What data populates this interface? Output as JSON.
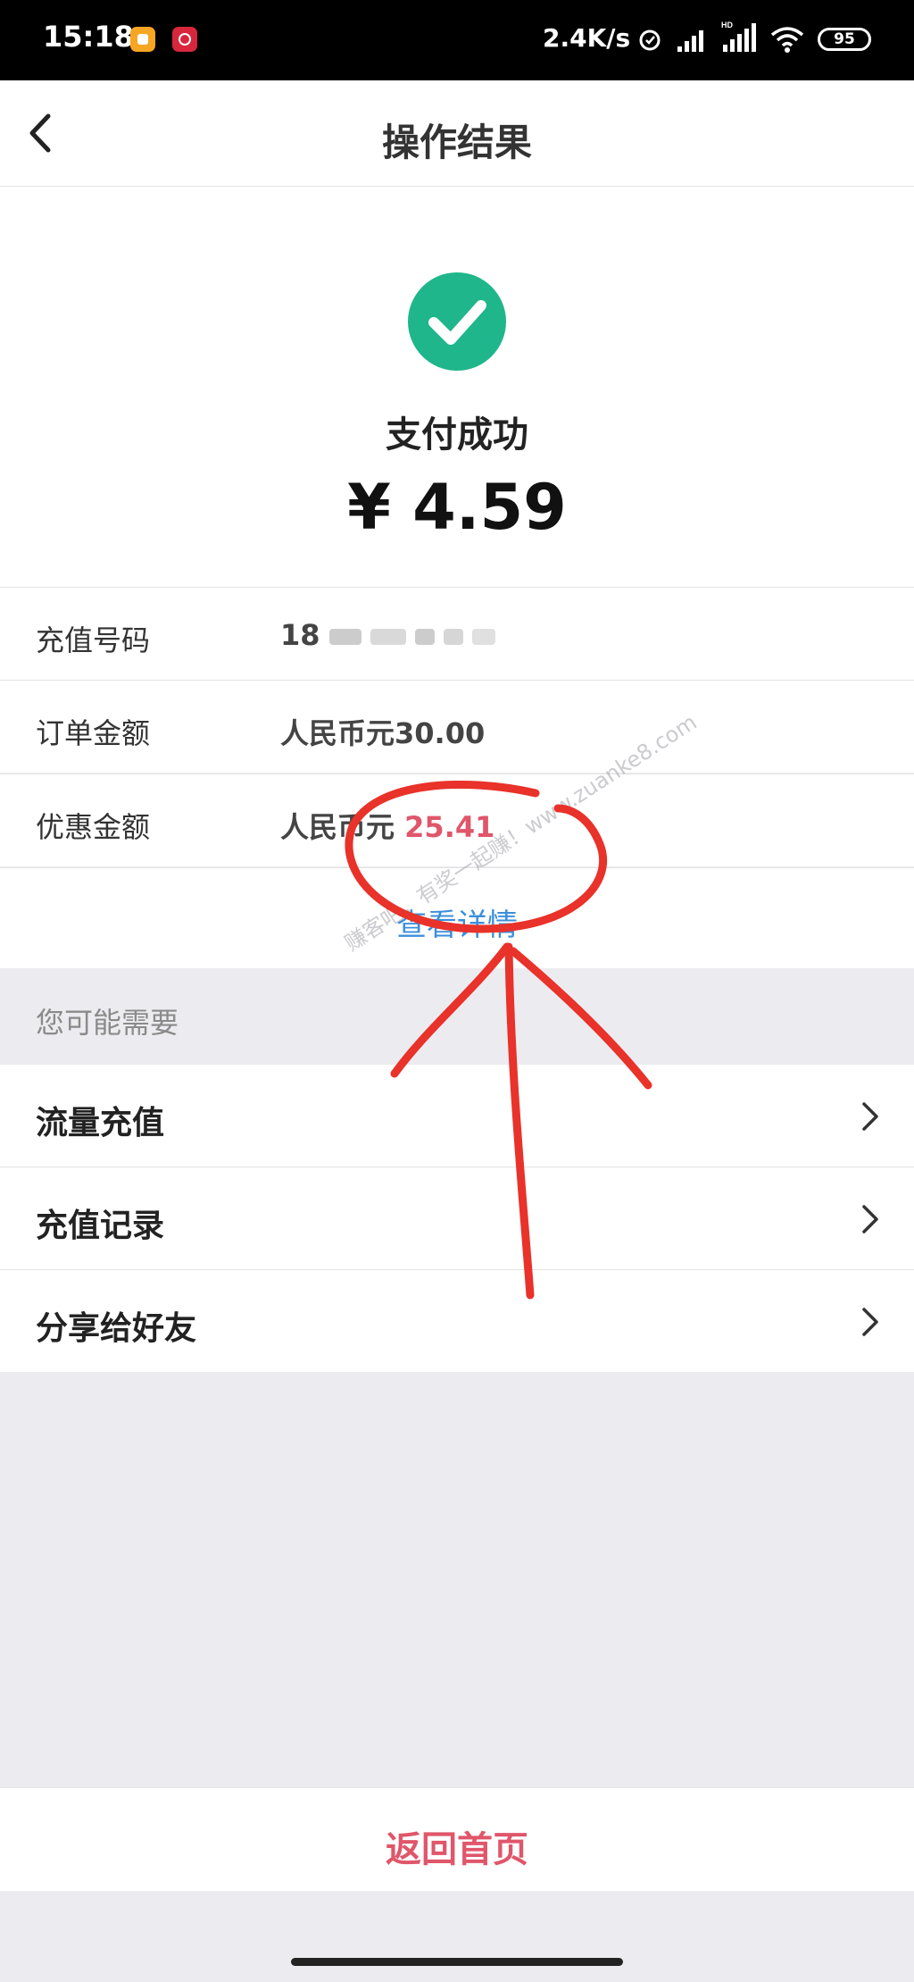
{
  "status_bar": {
    "time": "15:18",
    "net_speed": "2.4K/s",
    "battery": "95"
  },
  "nav": {
    "title": "操作结果"
  },
  "result": {
    "status": "支付成功",
    "amount": "¥ 4.59",
    "check_color": "#1fb68b"
  },
  "details": [
    {
      "label": "充值号码",
      "value": "18"
    },
    {
      "label": "订单金额",
      "value": "人民币元30.00"
    },
    {
      "label": "优惠金额",
      "value_prefix": "人民币元",
      "value_highlight": "25.41"
    }
  ],
  "detail_link": "查看详情",
  "suggest": {
    "heading": "您可能需要",
    "items": [
      {
        "label": "流量充值"
      },
      {
        "label": "充值记录"
      },
      {
        "label": "分享给好友"
      }
    ]
  },
  "bottom": {
    "home_button": "返回首页"
  },
  "watermark": "赚客吧，有奖一起赚！www.zuanke8.com",
  "colors": {
    "accent_red": "#e0566a",
    "link_blue": "#3b8fdb",
    "annotation_red": "#e8322a"
  }
}
